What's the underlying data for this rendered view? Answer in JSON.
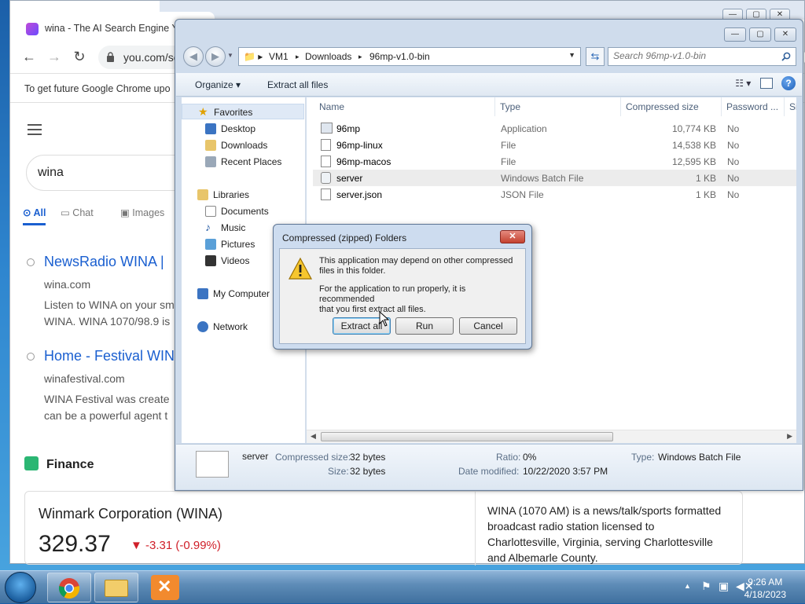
{
  "chrome": {
    "tab_title": "wina - The AI Search Engine Yo",
    "url": "you.com/se",
    "infobar": "To get future Google Chrome upo",
    "search_query": "wina",
    "search_tabs": [
      "All",
      "Chat",
      "Images"
    ],
    "results": [
      {
        "title": "NewsRadio WINA |",
        "url": "wina.com",
        "snippet1": "Listen to WINA on your sm",
        "snippet2": "WINA. WINA 1070/98.9 is"
      },
      {
        "title": "Home - Festival WIN",
        "url": "winafestival.com",
        "snippet1": "WINA Festival was create",
        "snippet2": "can be a powerful agent t"
      }
    ],
    "finance_label": "Finance",
    "stock": {
      "name": "Winmark Corporation (WINA)",
      "price": "329.37",
      "change": "-3.31 (-0.99%)",
      "description": "WINA (1070 AM) is a news/talk/sports formatted broadcast radio station licensed to Charlottesville, Virginia, serving Charlottesville and Albemarle County."
    }
  },
  "explorer": {
    "breadcrumbs": [
      "VM1",
      "Downloads",
      "96mp-v1.0-bin"
    ],
    "search_placeholder": "Search 96mp-v1.0-bin",
    "commands": {
      "organize": "Organize ▾",
      "extract": "Extract all files"
    },
    "nav": {
      "favorites": "Favorites",
      "desktop": "Desktop",
      "downloads": "Downloads",
      "recent": "Recent Places",
      "libraries": "Libraries",
      "documents": "Documents",
      "music": "Music",
      "pictures": "Pictures",
      "videos": "Videos",
      "computer": "My Computer",
      "network": "Network"
    },
    "columns": [
      "Name",
      "Type",
      "Compressed size",
      "Password ...",
      "Si"
    ],
    "files": [
      {
        "name": "96mp",
        "type": "Application",
        "size": "10,774 KB",
        "password": "No"
      },
      {
        "name": "96mp-linux",
        "type": "File",
        "size": "14,538 KB",
        "password": "No"
      },
      {
        "name": "96mp-macos",
        "type": "File",
        "size": "12,595 KB",
        "password": "No"
      },
      {
        "name": "server",
        "type": "Windows Batch File",
        "size": "1 KB",
        "password": "No"
      },
      {
        "name": "server.json",
        "type": "JSON File",
        "size": "1 KB",
        "password": "No"
      }
    ],
    "details": {
      "name": "server",
      "compressed_label": "Compressed size:",
      "compressed_value": "32 bytes",
      "size_label": "Size:",
      "size_value": "32 bytes",
      "ratio_label": "Ratio:",
      "ratio_value": "0%",
      "modified_label": "Date modified:",
      "modified_value": "10/22/2020 3:57 PM",
      "type_label": "Type:",
      "type_value": "Windows Batch File"
    }
  },
  "dialog": {
    "title": "Compressed (zipped) Folders",
    "line1a": "This application may depend on other compressed",
    "line1b": "files in this folder.",
    "line2a": "For the application to run properly, it is recommended",
    "line2b": "that you first extract all files.",
    "buttons": {
      "extract": "Extract all",
      "run": "Run",
      "cancel": "Cancel"
    }
  },
  "taskbar": {
    "time": "9:26 AM",
    "date": "4/18/2023"
  }
}
